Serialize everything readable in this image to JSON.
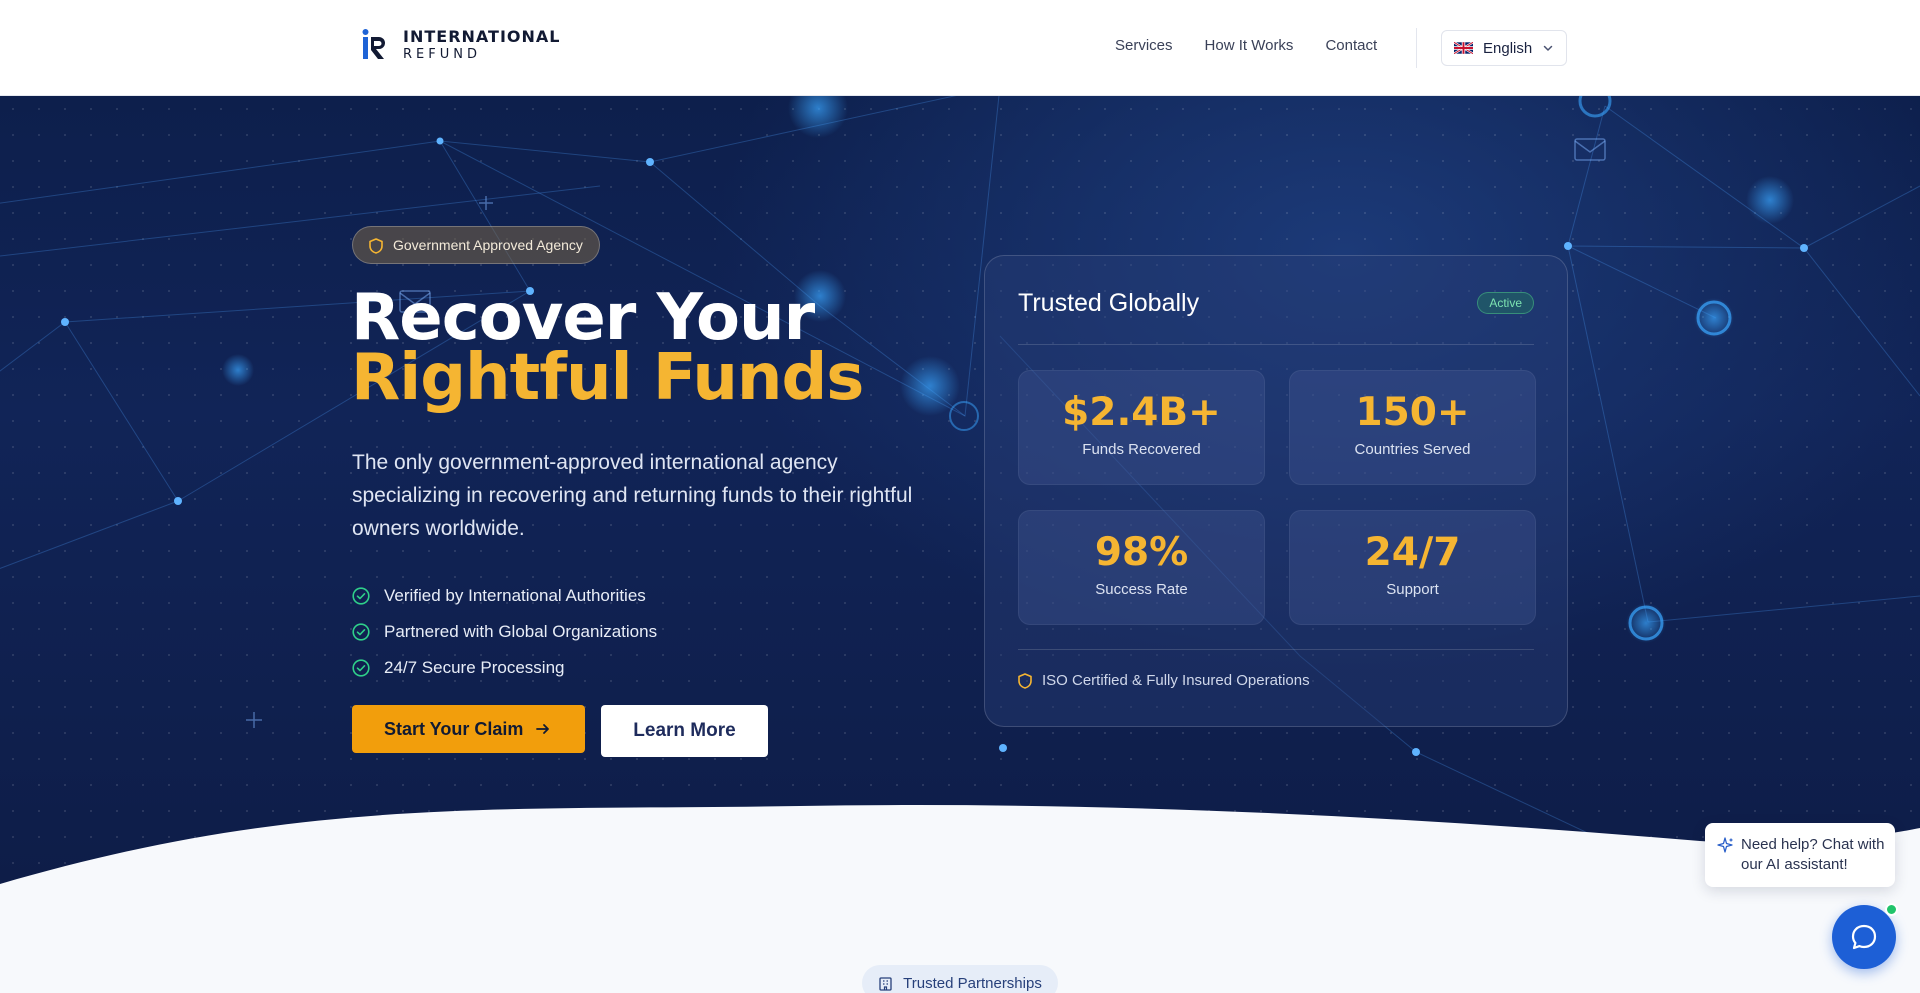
{
  "brand": {
    "name_line1": "INTERNATIONAL",
    "name_line2": "REFUND"
  },
  "nav": {
    "items": [
      {
        "label": "Services"
      },
      {
        "label": "How It Works"
      },
      {
        "label": "Contact"
      }
    ],
    "language": "English"
  },
  "hero": {
    "badge": "Government Approved Agency",
    "title_line1": "Recover Your",
    "title_line2": "Rightful Funds",
    "subtitle": "The only government-approved international agency specializing in recovering and returning funds to their rightful owners worldwide.",
    "checks": [
      "Verified by International Authorities",
      "Partnered with Global Organizations",
      "24/7 Secure Processing"
    ],
    "cta_primary": "Start Your Claim",
    "cta_secondary": "Learn More"
  },
  "card": {
    "title": "Trusted Globally",
    "status": "Active",
    "stats": [
      {
        "value": "$2.4B+",
        "label": "Funds Recovered"
      },
      {
        "value": "150+",
        "label": "Countries Served"
      },
      {
        "value": "98%",
        "label": "Success Rate"
      },
      {
        "value": "24/7",
        "label": "Support"
      }
    ],
    "footer": "ISO Certified & Fully Insured Operations"
  },
  "chat": {
    "prompt": "Need help? Chat with our AI assistant!"
  },
  "section": {
    "pill": "Trusted Partnerships"
  },
  "colors": {
    "accent": "#f5b532",
    "cta": "#f29e0c",
    "hero_bg": "#0d1f4c",
    "chat_blue": "#1d5fd6",
    "online_green": "#21c46b"
  },
  "icons": {
    "logo": "ir-logo-icon",
    "flag": "uk-flag-icon",
    "chevron": "chevron-down-icon",
    "shield": "shield-icon",
    "check": "check-circle-icon",
    "arrow": "arrow-right-icon",
    "sparkle": "sparkle-icon",
    "chat": "chat-bubble-icon",
    "building": "building-icon"
  }
}
